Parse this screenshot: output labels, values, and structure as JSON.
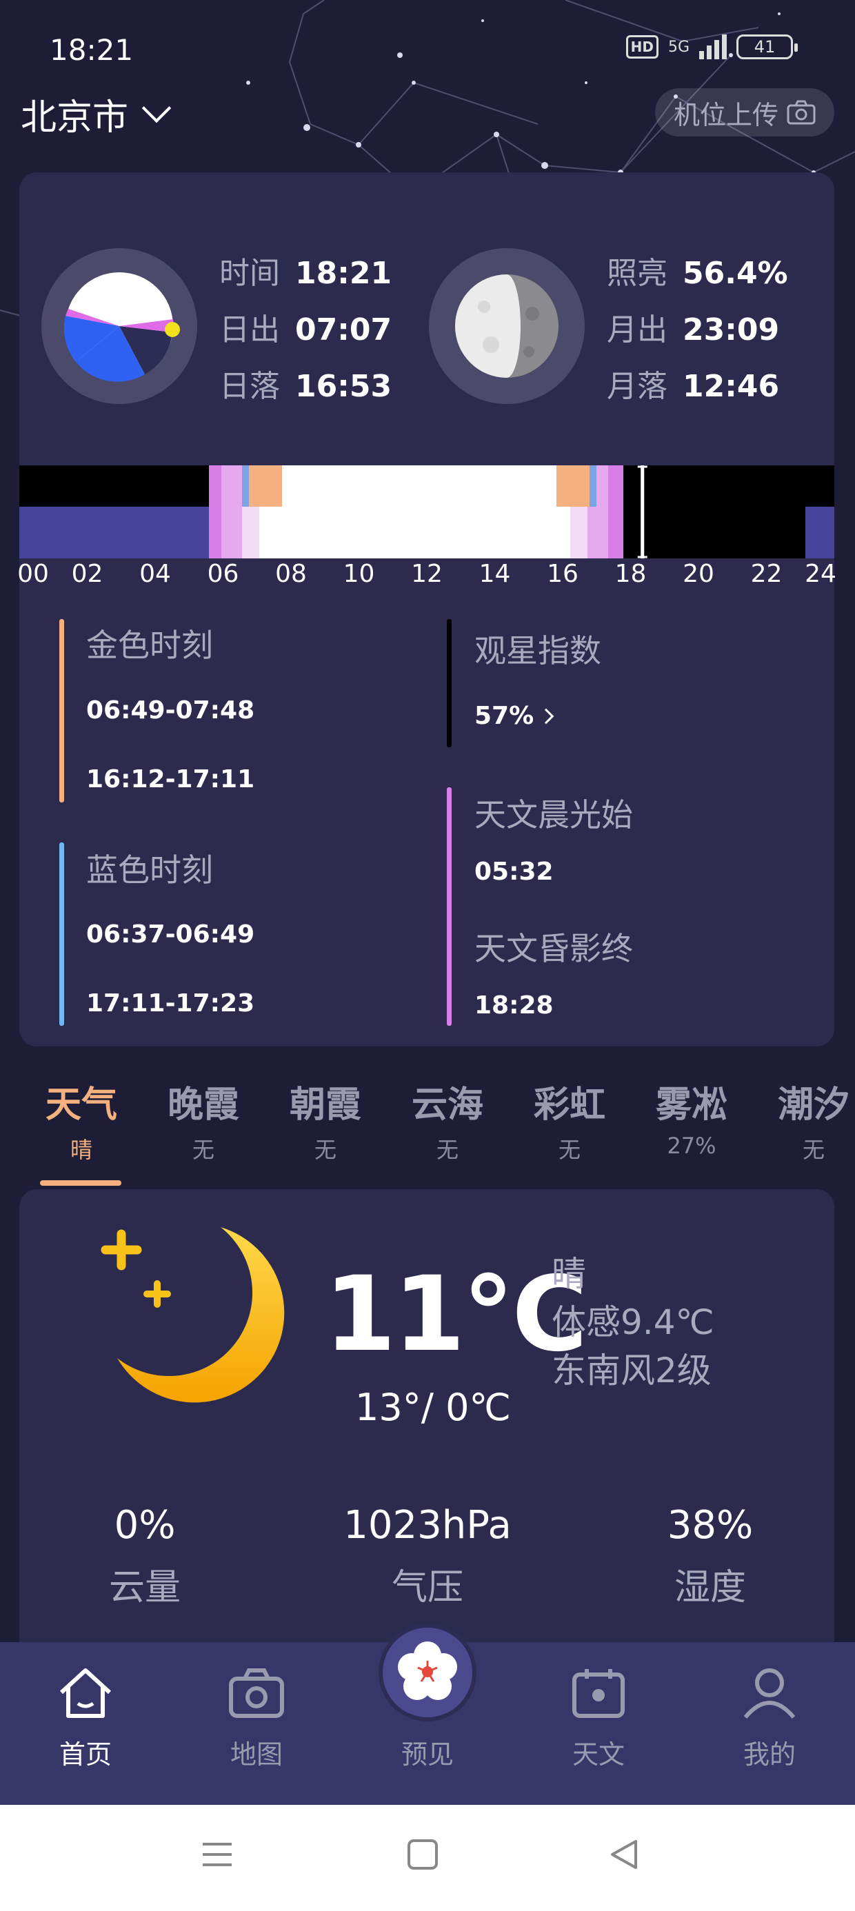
{
  "status_bar": {
    "time": "18:21",
    "hd": "HD",
    "network": "5G",
    "battery": "41"
  },
  "header": {
    "city": "北京市",
    "upload_label": "机位上传"
  },
  "sun": {
    "time_label": "时间",
    "time_value": "18:21",
    "sunrise_label": "日出",
    "sunrise_value": "07:07",
    "sunset_label": "日落",
    "sunset_value": "16:53"
  },
  "moon": {
    "illumination_label": "照亮",
    "illumination_value": "56.4%",
    "moonrise_label": "月出",
    "moonrise_value": "23:09",
    "moonset_label": "月落",
    "moonset_value": "12:46"
  },
  "timeline": {
    "ticks": [
      "00",
      "02",
      "04",
      "06",
      "08",
      "10",
      "12",
      "14",
      "16",
      "18",
      "20",
      "22",
      "24"
    ],
    "current_hour": 18.35
  },
  "golden_hour": {
    "label": "金色时刻",
    "morning": "06:49-07:48",
    "evening": "16:12-17:11",
    "color": "#f4b07e"
  },
  "blue_hour": {
    "label": "蓝色时刻",
    "morning": "06:37-06:49",
    "evening": "17:11-17:23",
    "color": "#6fb8f0"
  },
  "stargazing": {
    "label": "观星指数",
    "value": "57%"
  },
  "astro": {
    "dawn_label": "天文晨光始",
    "dawn_value": "05:32",
    "dusk_label": "天文昏影终",
    "dusk_value": "18:28",
    "color": "#d77fe6"
  },
  "tabs": [
    {
      "title": "天气",
      "sub": "晴"
    },
    {
      "title": "晚霞",
      "sub": "无"
    },
    {
      "title": "朝霞",
      "sub": "无"
    },
    {
      "title": "云海",
      "sub": "无"
    },
    {
      "title": "彩虹",
      "sub": "无"
    },
    {
      "title": "雾凇",
      "sub": "27%"
    },
    {
      "title": "潮汐",
      "sub": "无"
    }
  ],
  "weather": {
    "temp": "11℃",
    "range": "13°/ 0℃",
    "condition": "晴",
    "feels_like": "体感9.4℃",
    "wind": "东南风2级",
    "cloud_value": "0%",
    "cloud_label": "云量",
    "pressure_value": "1023hPa",
    "pressure_label": "气压",
    "humidity_value": "38%",
    "humidity_label": "湿度"
  },
  "nav": [
    {
      "label": "首页",
      "icon": "home-icon"
    },
    {
      "label": "地图",
      "icon": "camera-icon"
    },
    {
      "label": "预见",
      "icon": "flower-icon"
    },
    {
      "label": "天文",
      "icon": "calendar-icon"
    },
    {
      "label": "我的",
      "icon": "user-icon"
    }
  ]
}
